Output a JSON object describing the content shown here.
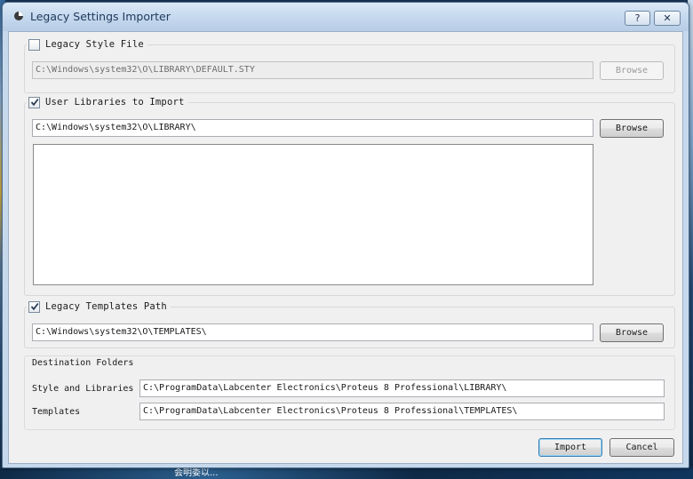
{
  "window": {
    "title": "Legacy Settings Importer",
    "help_label": "?",
    "close_label": "✕"
  },
  "legacy_style": {
    "checkbox_label": "Legacy Style File",
    "checked": false,
    "path": "C:\\Windows\\system32\\O\\LIBRARY\\DEFAULT.STY",
    "browse_label": "Browse",
    "enabled": false
  },
  "user_libraries": {
    "checkbox_label": "User Libraries to Import",
    "checked": true,
    "path": "C:\\Windows\\system32\\O\\LIBRARY\\",
    "browse_label": "Browse",
    "items": []
  },
  "legacy_templates": {
    "checkbox_label": "Legacy Templates Path",
    "checked": true,
    "path": "C:\\Windows\\system32\\O\\TEMPLATES\\",
    "browse_label": "Browse"
  },
  "destination": {
    "title": "Destination Folders",
    "style_label": "Style and Libraries",
    "style_path": "C:\\ProgramData\\Labcenter Electronics\\Proteus 8 Professional\\LIBRARY\\",
    "templates_label": "Templates",
    "templates_path": "C:\\ProgramData\\Labcenter Electronics\\Proteus 8 Professional\\TEMPLATES\\"
  },
  "actions": {
    "import_label": "Import",
    "cancel_label": "Cancel"
  },
  "desktop": {
    "taskbar_text": "会明委以..."
  }
}
